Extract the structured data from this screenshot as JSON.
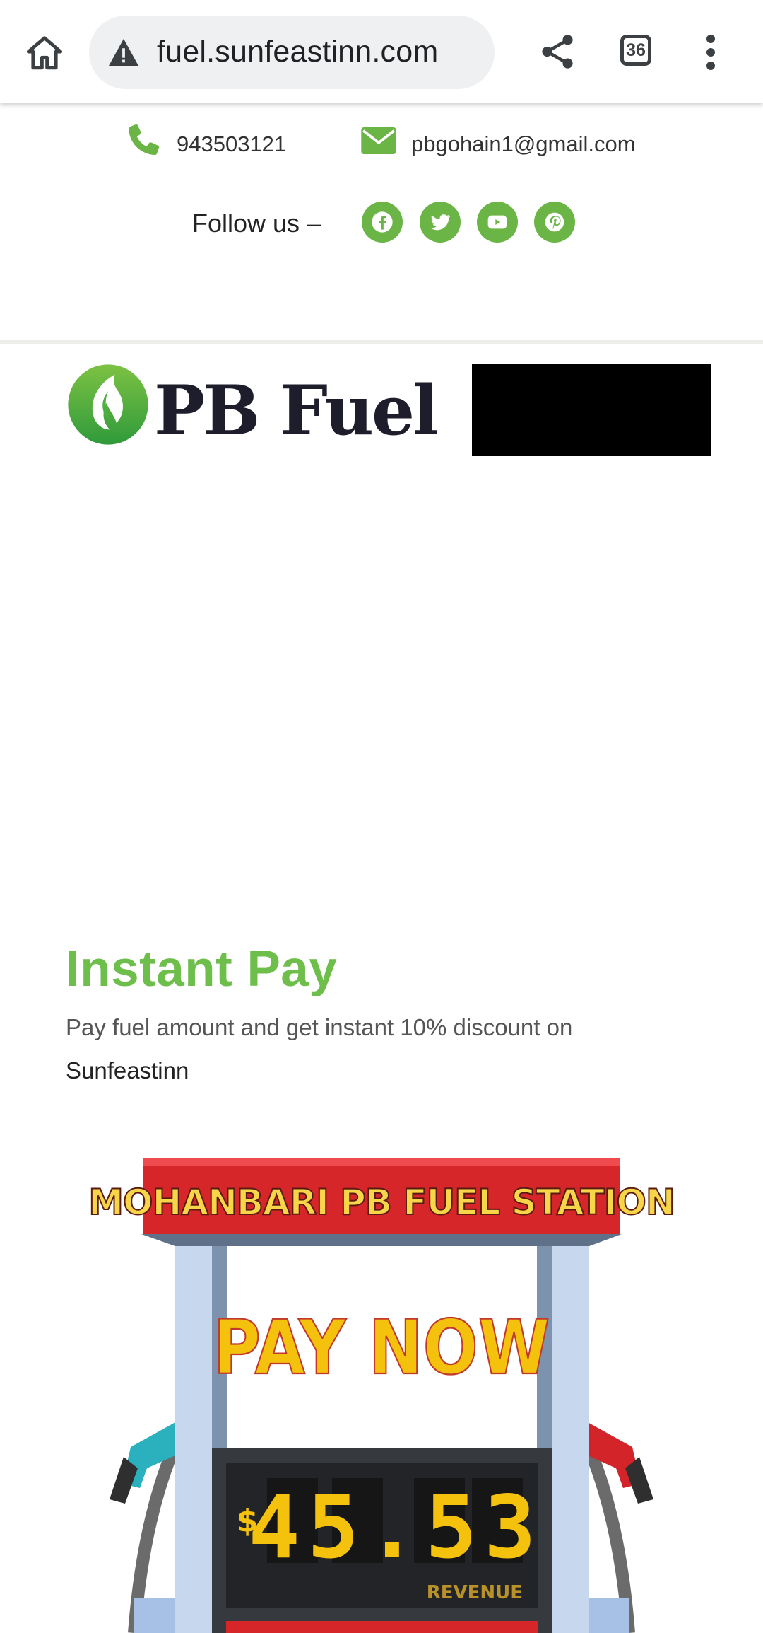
{
  "browser": {
    "url": "fuel.sunfeastinn.com",
    "tab_count": "36",
    "icons": [
      "home-icon",
      "warning-icon",
      "share-icon",
      "tabs-icon",
      "more-icon"
    ]
  },
  "topbar": {
    "phone": "943503121",
    "email": "pbgohain1@gmail.com",
    "follow_label": "Follow us –",
    "social": [
      "facebook-icon",
      "twitter-icon",
      "youtube-icon",
      "pinterest-icon"
    ]
  },
  "header": {
    "logo_text": "PB Fuel"
  },
  "instant_pay": {
    "title": "Instant Pay",
    "description": "Pay fuel amount and get instant 10% discount on",
    "description_link": "Sunfeastinn"
  },
  "pump": {
    "station_name": "MOHANBARI PB FUEL STATION",
    "cta": "PAY NOW",
    "currency": "$",
    "amount": "45.53",
    "display_label": "REVENUE"
  },
  "colors": {
    "brand_green": "#6ab545",
    "title_green": "#6ebe4b",
    "sign_red": "#d6262a",
    "digit_yellow": "#f4c20d"
  }
}
